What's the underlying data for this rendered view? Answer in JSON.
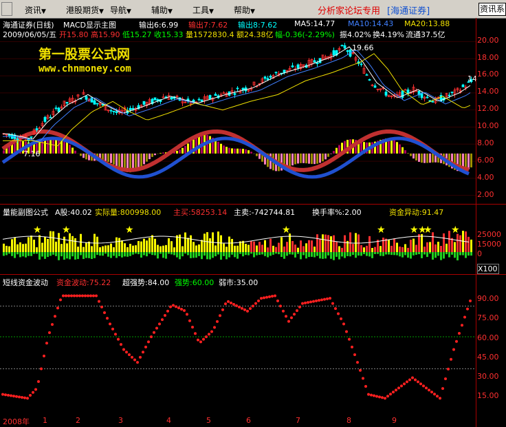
{
  "menu": {
    "items": [
      {
        "label": "资讯",
        "arrow": "▼"
      },
      {
        "label": "港股期货",
        "arrow": "▼"
      },
      {
        "label": "导航",
        "arrow": "▼"
      },
      {
        "label": "辅助",
        "arrow": "▼"
      },
      {
        "label": "工具",
        "arrow": "▼"
      },
      {
        "label": "帮助",
        "arrow": "▼"
      }
    ],
    "brand": "分析家论坛专用",
    "brand_tag": "[海通证券]",
    "right_button": "资讯系"
  },
  "main_panel": {
    "title": "海通证券(日线)",
    "indicator": "MACD显示主图",
    "out1": "输出6:6.99",
    "out2": "输出7:7.62",
    "out3": "输出8:7.62",
    "ma5": "MA5:14.77",
    "ma10": "MA10:14.43",
    "ma20": "MA20:13.88",
    "date": "2009/06/05/五",
    "open": "开15.80",
    "high": "高15.90",
    "low": "低15.27",
    "close": "收15.33",
    "volume": "量1572830.4",
    "amount": "额24.38亿",
    "change": "幅-0.36(-2.29%)",
    "amplitude": "振4.02%",
    "turnover": "换4.19%",
    "float": "流通37.5亿",
    "high_marker": "19.66",
    "low_marker": "7.16",
    "last_marker": "14",
    "watermark": "第一股票公式网",
    "watermark_url": "www.chnmoney.com",
    "y_ticks": [
      "20.00",
      "18.00",
      "16.00",
      "14.00",
      "12.00",
      "10.00",
      "8.00",
      "6.00",
      "4.00",
      "2.00"
    ]
  },
  "volume_panel": {
    "title": "量能副图公式",
    "a_share": "A股:40.02",
    "actual": "实际量:800998.00",
    "buy": "主买:58253.14",
    "sell": "主卖:-742744.81",
    "turnover": "换手率%:2.00",
    "fund_change": "资金异动:91.47",
    "y_ticks": [
      "25000",
      "15000",
      "0"
    ],
    "unit": "X100"
  },
  "wave_panel": {
    "title": "短线资金波动",
    "fund_wave": "资金波动:75.22",
    "super_strong": "超强势:84.00",
    "strong": "强势:60.00",
    "weak": "弱市:35.00",
    "y_ticks": [
      "90.00",
      "75.00",
      "60.00",
      "45.00",
      "30.00",
      "15.00"
    ]
  },
  "date_axis": {
    "labels": [
      "2008年",
      "1",
      "2",
      "3",
      "4",
      "5",
      "6",
      "7",
      "8",
      "9"
    ]
  },
  "colors": {
    "up": "#ff3030",
    "down": "#00ffff",
    "ma5": "#ffffff",
    "ma10": "#4080ff",
    "ma20": "#f0e000",
    "grid": "#aa0000",
    "macd_pos": "#ffff00",
    "macd_neg": "#ff80c0",
    "wave": "#ff2020"
  }
}
